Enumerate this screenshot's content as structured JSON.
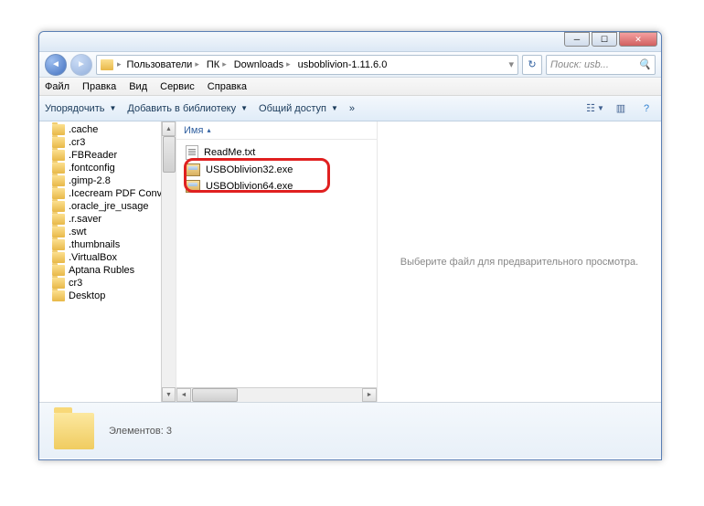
{
  "breadcrumbs": [
    "Пользователи",
    "ПК",
    "Downloads",
    "usboblivion-1.11.6.0"
  ],
  "search_placeholder": "Поиск: usb...",
  "menu": {
    "file": "Файл",
    "edit": "Правка",
    "view": "Вид",
    "tools": "Сервис",
    "help": "Справка"
  },
  "toolbar": {
    "organize": "Упорядочить",
    "library": "Добавить в библиотеку",
    "share": "Общий доступ",
    "burn": "»"
  },
  "tree_items": [
    ".cache",
    ".cr3",
    ".FBReader",
    ".fontconfig",
    ".gimp-2.8",
    ".Icecream PDF Conv",
    ".oracle_jre_usage",
    ".r.saver",
    ".swt",
    ".thumbnails",
    ".VirtualBox",
    "Aptana Rubles",
    "cr3",
    "Desktop"
  ],
  "column_header": "Имя",
  "files": [
    {
      "name": "ReadMe.txt",
      "type": "txt"
    },
    {
      "name": "USBOblivion32.exe",
      "type": "exe"
    },
    {
      "name": "USBOblivion64.exe",
      "type": "exe"
    }
  ],
  "preview_text": "Выберите файл для предварительного просмотра.",
  "status_label": "Элементов:",
  "status_count": "3"
}
